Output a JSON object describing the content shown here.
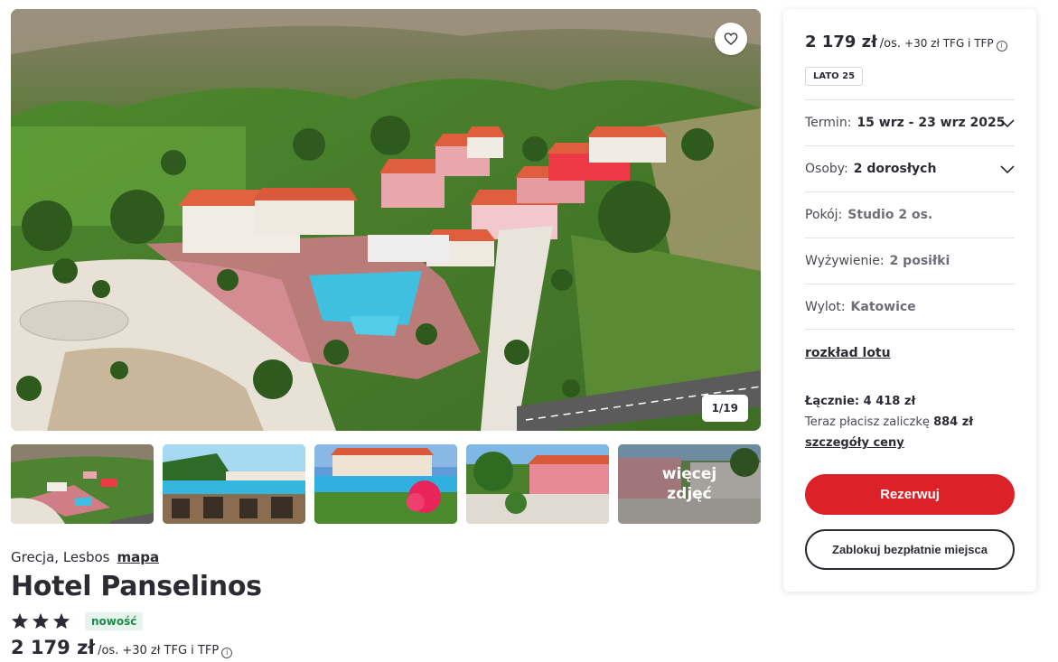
{
  "gallery": {
    "counter": "1/19",
    "more_photos_label": "więcej zdjęć",
    "favorite_icon": "heart-icon"
  },
  "hotel": {
    "location": "Grecja, Lesbos",
    "map_link": "mapa",
    "name": "Hotel Panselinos",
    "stars": 3,
    "badge": "nowość",
    "price": "2 179 zł",
    "per_person": "/os.",
    "fees": "+30 zł TFG i TFP"
  },
  "booking": {
    "price": "2 179 zł",
    "per_person": "/os.",
    "fees": "+30 zł TFG i TFP",
    "season_tag": "LATO 25",
    "term_label": "Termin:",
    "term_value": "15 wrz - 23 wrz 2025",
    "persons_label": "Osoby:",
    "persons_value": "2 dorosłych",
    "room_label": "Pokój:",
    "room_value": "Studio 2 os.",
    "board_label": "Wyżywienie:",
    "board_value": "2 posiłki",
    "departure_label": "Wylot:",
    "departure_value": "Katowice",
    "flight_schedule_link": "rozkład lotu",
    "total": "Łącznie: 4 418 zł",
    "deposit_prefix": "Teraz płacisz zaliczkę",
    "deposit_amount": "884 zł",
    "price_details_link": "szczegóły ceny",
    "reserve_button": "Rezerwuj",
    "lock_button": "Zablokuj bezpłatnie miejsca"
  },
  "colors": {
    "accent_red": "#dc2228",
    "badge_green": "#1f8a4c",
    "text_dark": "#2b2b33"
  }
}
